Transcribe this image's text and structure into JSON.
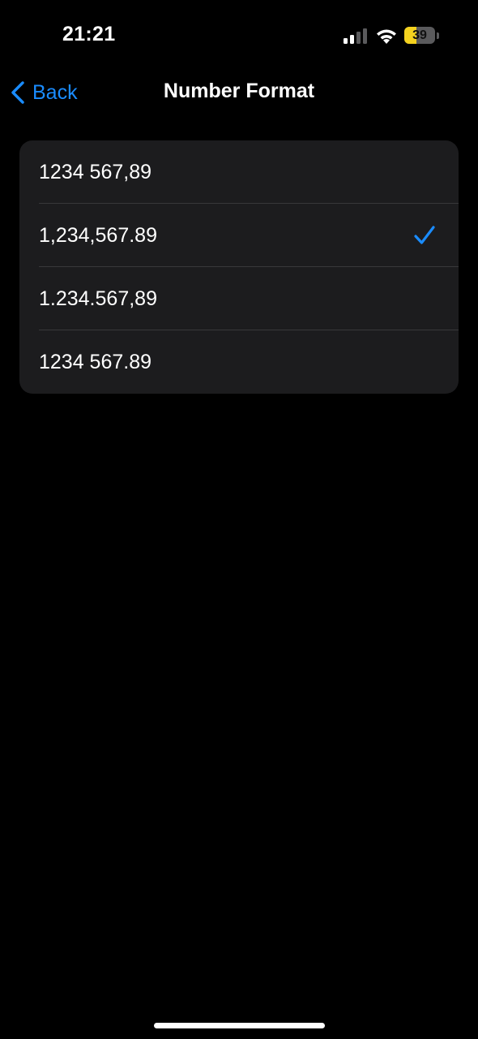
{
  "status_bar": {
    "time": "21:21",
    "battery_percent": "39",
    "battery_level": 0.39,
    "battery_color": "#f4d21f",
    "signal_icon": "cellular-signal-icon",
    "wifi_icon": "wifi-icon"
  },
  "nav": {
    "back_label": "Back",
    "title": "Number Format",
    "accent_color": "#1a8cff"
  },
  "options": [
    {
      "label": "1234 567,89",
      "selected": false
    },
    {
      "label": "1,234,567.89",
      "selected": true
    },
    {
      "label": "1.234.567,89",
      "selected": false
    },
    {
      "label": "1234 567.89",
      "selected": false
    }
  ]
}
